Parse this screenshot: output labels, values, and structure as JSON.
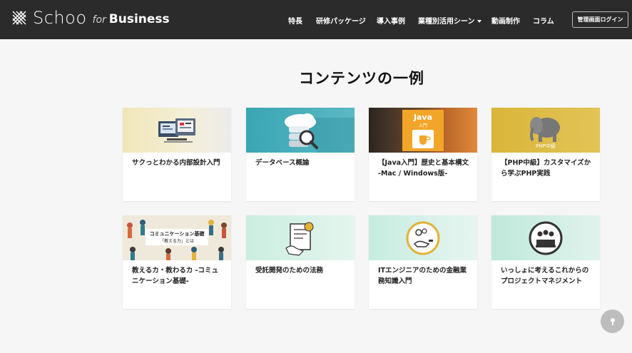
{
  "brand": {
    "word": "Schoo",
    "for": "for",
    "business": "Business"
  },
  "nav": {
    "items": [
      "特長",
      "研修パッケージ",
      "導入事例",
      "業種別活用シーン",
      "動画制作",
      "コラム"
    ],
    "login": "管理画面ログイン"
  },
  "section": {
    "title": "コンテンツの一例"
  },
  "cards": [
    {
      "title": "サクっとわかる内部設計入門",
      "thumb_icon": "computer-monitor-icon"
    },
    {
      "title": "データベース概論",
      "thumb_icon": "database-cloud-icon"
    },
    {
      "title": "【Java入門】歴史と基本構文 -Mac / Windows版-",
      "thumb_icon": "java-logo",
      "badge_line1": "Java",
      "badge_line2": "入門"
    },
    {
      "title": "【PHP中級】カスタマイズから学ぶPHP実践",
      "thumb_icon": "elephant-icon",
      "thumb_text": "PHP中級"
    },
    {
      "title": "教えるカ・教わるカ -コミュニケーション基礎-",
      "thumb_icon": "people-illustration",
      "thumb_text1": "コミュニケーション基礎",
      "thumb_text2": "「教える力」とは"
    },
    {
      "title": "受託開発のための法務",
      "thumb_icon": "contract-document-icon"
    },
    {
      "title": "ITエンジニアのための金融業務知識入門",
      "thumb_icon": "finance-icon"
    },
    {
      "title": "いっしょに考えるこれからのプロジェクトマネジメント",
      "thumb_icon": "team-meeting-icon"
    }
  ],
  "colors": {
    "header_bg": "#2b2b2b",
    "page_bg": "#f6f6f6",
    "accent": "#e9a52b"
  }
}
